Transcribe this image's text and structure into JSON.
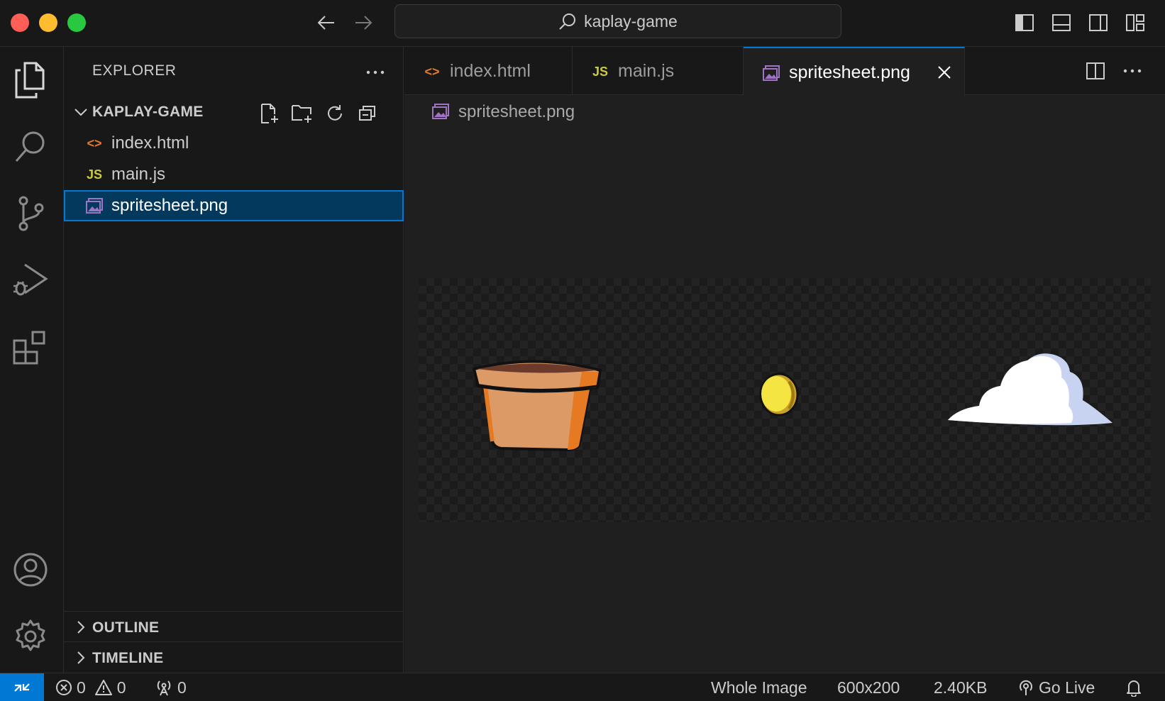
{
  "titlebar": {
    "search_text": "kaplay-game",
    "icons": [
      "arrow-left-icon",
      "arrow-right-icon",
      "search-icon",
      "toggle-primary-sidebar-icon",
      "toggle-panel-icon",
      "toggle-secondary-sidebar-icon",
      "customize-layout-icon"
    ]
  },
  "activity_bar": {
    "items": [
      "explorer",
      "search",
      "source-control",
      "run-and-debug",
      "extensions"
    ],
    "bottom": [
      "accounts",
      "manage"
    ]
  },
  "sidebar": {
    "title": "EXPLORER",
    "folder": {
      "name": "KAPLAY-GAME",
      "expanded": true
    },
    "files": [
      {
        "name": "index.html",
        "icon": "<>",
        "icon_color": "#e37933"
      },
      {
        "name": "main.js",
        "icon": "JS",
        "icon_color": "#cbcb41"
      },
      {
        "name": "spritesheet.png",
        "icon": "image-file-icon",
        "icon_color": "#a074c4",
        "selected": true
      }
    ],
    "panes": [
      {
        "name": "OUTLINE"
      },
      {
        "name": "TIMELINE"
      }
    ]
  },
  "editor": {
    "tabs": [
      {
        "label": "index.html",
        "icon": "<>",
        "icon_color": "#e37933",
        "active": false
      },
      {
        "label": "main.js",
        "icon": "JS",
        "icon_color": "#cbcb41",
        "active": false
      },
      {
        "label": "spritesheet.png",
        "icon": "image-file-icon",
        "icon_color": "#a074c4",
        "active": true
      }
    ],
    "breadcrumb": "spritesheet.png",
    "image": {
      "sprites": [
        "flower-pot",
        "coin",
        "cloud"
      ]
    }
  },
  "statusbar": {
    "errors": "0",
    "warnings": "0",
    "ports": "0",
    "zoom": "Whole Image",
    "dimensions": "600x200",
    "size": "2.40KB",
    "go_live": "Go Live"
  },
  "colors": {
    "accent": "#0078d4",
    "selection": "#04395e",
    "background": "#181818",
    "editor_background": "#1f1f1f"
  }
}
